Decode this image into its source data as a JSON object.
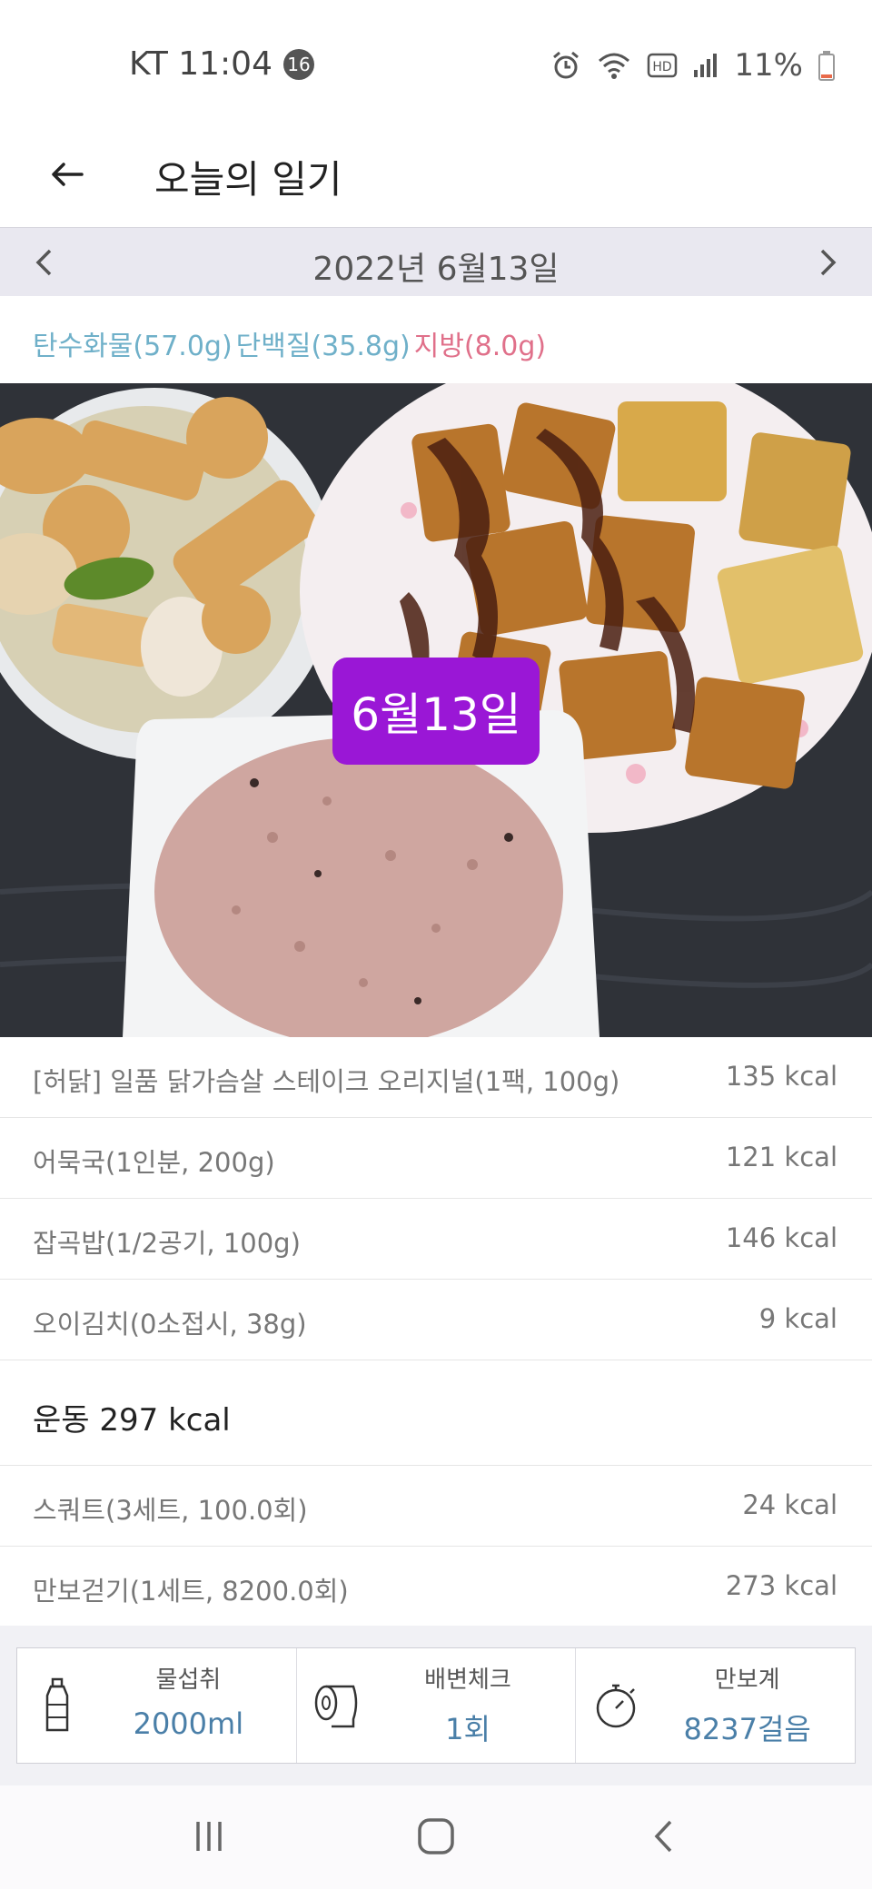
{
  "status_bar": {
    "carrier_time": "KT 11:04",
    "notification_count": "16",
    "battery": "11%",
    "icons": [
      "alarm-icon",
      "wifi-icon",
      "hd-icon",
      "signal-icon",
      "battery-icon"
    ]
  },
  "header": {
    "title": "오늘의 일기",
    "back_icon": "arrow-left-icon"
  },
  "date_nav": {
    "date": "2022년 6월13일",
    "prev_icon": "chevron-left-icon",
    "next_icon": "chevron-right-icon"
  },
  "macros": {
    "carb": "탄수화물(57.0g)",
    "protein": "단백질(35.8g)",
    "fat": "지방(8.0g)",
    "colors": {
      "carb": "#6fb0c9",
      "protein": "#6fb0c9",
      "fat": "#e0708a"
    }
  },
  "photo": {
    "overlay_label": "6월13일",
    "overlay_color": "#9a17d6"
  },
  "foods": [
    {
      "name": "[허닭] 일품 닭가슴살 스테이크 오리지널(1팩, 100g)",
      "kcal": "135 kcal"
    },
    {
      "name": "어묵국(1인분, 200g)",
      "kcal": "121 kcal"
    },
    {
      "name": "잡곡밥(1/2공기, 100g)",
      "kcal": "146 kcal"
    },
    {
      "name": "오이김치(0소접시, 38g)",
      "kcal": "9 kcal"
    }
  ],
  "exercise": {
    "title": "운동 297 kcal",
    "items": [
      {
        "name": "스쿼트(3세트, 100.0회)",
        "kcal": "24 kcal"
      },
      {
        "name": "만보걷기(1세트, 8200.0회)",
        "kcal": "273 kcal"
      }
    ]
  },
  "trackers": [
    {
      "label": "물섭취",
      "value": "2000ml",
      "icon": "water-bottle-icon"
    },
    {
      "label": "배변체크",
      "value": "1회",
      "icon": "toilet-paper-icon"
    },
    {
      "label": "만보계",
      "value": "8237걸음",
      "icon": "stopwatch-icon"
    }
  ],
  "nav": {
    "icons": [
      "recents-icon",
      "home-icon",
      "back-icon"
    ]
  }
}
